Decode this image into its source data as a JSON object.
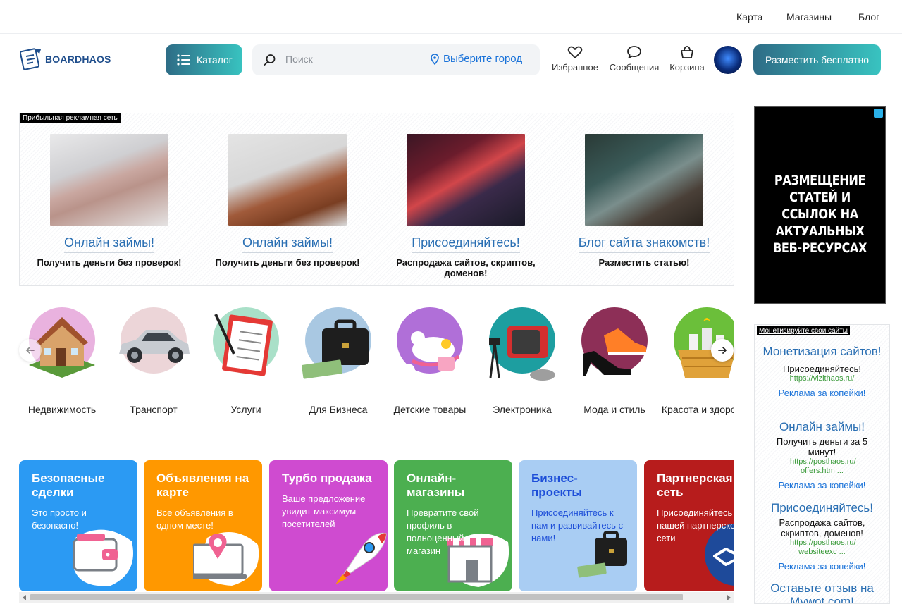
{
  "topnav": {
    "map": "Карта",
    "shops": "Магазины",
    "blog": "Блог"
  },
  "header": {
    "logo_text": "BOARDHAOS",
    "catalog_label": "Каталог",
    "search_placeholder": "Поиск",
    "city_label": "Выберите город",
    "favorites_label": "Избранное",
    "messages_label": "Сообщения",
    "cart_label": "Корзина",
    "post_button": "Разместить бесплатно"
  },
  "ad_network": {
    "tag": "Прибыльная рекламная сеть",
    "items": [
      {
        "title": "Онлайн займы!",
        "desc": "Получить деньги без проверок!"
      },
      {
        "title": "Онлайн займы!",
        "desc": "Получить деньги без проверок!"
      },
      {
        "title": "Присоединяйтесь!",
        "desc": "Распродажа сайтов, скриптов, доменов!"
      },
      {
        "title": "Блог сайта знакомств!",
        "desc": "Разместить статью!"
      }
    ]
  },
  "banner": {
    "text": "РАЗМЕЩЕНИЕ СТАТЕЙ И ССЫЛОК НА АКТУАЛЬНЫХ ВЕБ-РЕСУРСАХ"
  },
  "categories": [
    {
      "label": "Недвижимость",
      "icon": "house-icon"
    },
    {
      "label": "Транспорт",
      "icon": "car-icon"
    },
    {
      "label": "Услуги",
      "icon": "clipboard-icon"
    },
    {
      "label": "Для Бизнеса",
      "icon": "briefcase-icon"
    },
    {
      "label": "Детские товары",
      "icon": "toys-icon"
    },
    {
      "label": "Электроника",
      "icon": "tv-icon"
    },
    {
      "label": "Мода и стиль",
      "icon": "shoes-icon"
    },
    {
      "label": "Красота и здоровье",
      "icon": "gift-basket-icon"
    }
  ],
  "tiles": [
    {
      "title": "Безопасные сделки",
      "desc": "Это просто и безопасно!",
      "color": "#2b9af3"
    },
    {
      "title": "Объявления на карте",
      "desc": "Все объявления в одном месте!",
      "color": "#ff9800"
    },
    {
      "title": "Турбо продажа",
      "desc": "Ваше предложение увидит максимум посетителей",
      "color": "#cf4bd0"
    },
    {
      "title": "Онлайн-магазины",
      "desc": "Превратите свой профиль в полноценный магазин",
      "color": "#4caf50"
    },
    {
      "title": "Бизнес-проекты",
      "desc": "Присоединяйтесь к нам и развивайтесь с нами!",
      "color": "#a9cdf3"
    },
    {
      "title": "Партнерская сеть",
      "desc": "Присоединяйтесь к нашей партнерской сети",
      "color": "#b71c1c"
    }
  ],
  "sidebar": {
    "tag": "Монетизируйте свои сайты",
    "blocks": [
      {
        "title": "Монетизация сайтов!",
        "desc": "Присоединяйтесь!",
        "url": "https://vizithaos.ru/",
        "link": "Реклама за копейки!"
      },
      {
        "title": "Онлайн займы!",
        "desc": "Получить деньги за 5 минут!",
        "url": "https://posthaos.ru/ offers.htm ...",
        "link": "Реклама за копейки!"
      },
      {
        "title": "Присоединяйтесь!",
        "desc": "Распродажа сайтов, скриптов, доменов!",
        "url": "https://posthaos.ru/ websiteexc ...",
        "link": "Реклама за копейки!"
      },
      {
        "title": "Оставьте отзыв на Mywot.com!",
        "desc": "",
        "url": "",
        "link": ""
      }
    ]
  }
}
